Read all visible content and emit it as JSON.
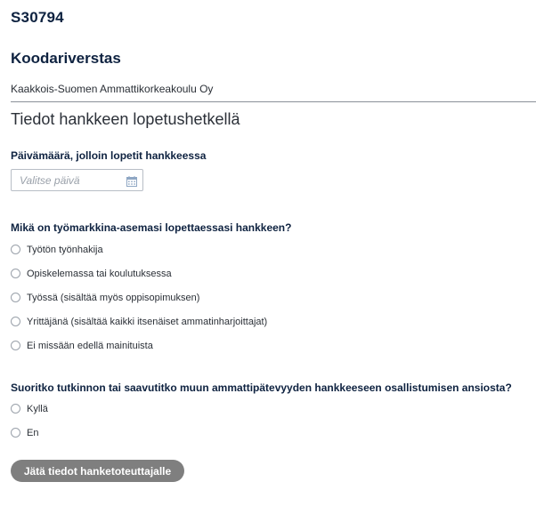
{
  "header": {
    "project_id": "S30794",
    "project_name": "Koodariverstas",
    "organization": "Kaakkois-Suomen Ammattikorkeakoulu Oy"
  },
  "form": {
    "section_title": "Tiedot hankkeen lopetushetkellä",
    "end_date": {
      "label": "Päivämäärä, jolloin lopetit hankkeessa",
      "placeholder": "Valitse päivä",
      "icon": "calendar-icon"
    },
    "labor_status": {
      "question": "Mikä on työmarkkina-asemasi lopettaessasi hankkeen?",
      "options": [
        "Työtön työnhakija",
        "Opiskelemassa tai koulutuksessa",
        "Työssä (sisältää myös oppisopimuksen)",
        "Yrittäjänä (sisältää kaikki itsenäiset ammatinharjoittajat)",
        "Ei missään edellä mainituista"
      ]
    },
    "qualification": {
      "question": "Suoritko tutkinnon tai saavutitko muun ammattipätevyyden hankkeeseen osallistumisen ansiosta?",
      "options": [
        "Kyllä",
        "En"
      ]
    },
    "submit_label": "Jätä tiedot hanketoteuttajalle"
  },
  "colors": {
    "heading": "#0e2240",
    "button_bg": "#7f7f7f",
    "divider": "#8a9099"
  }
}
